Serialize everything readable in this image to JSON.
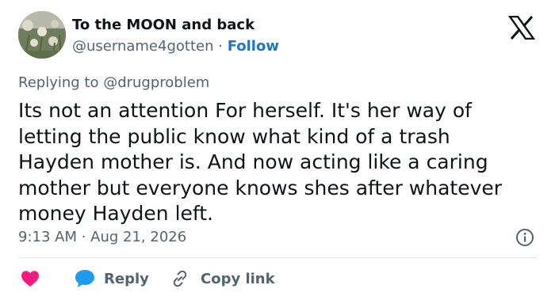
{
  "author": {
    "name": "To the MOON and back",
    "handle": "@username4gotten",
    "separator": "·",
    "follow_label": "Follow"
  },
  "logo": "x-logo-icon",
  "replying_to": "Replying to @drugproblem",
  "body": "Its not an attention For herself.  It's her way of\nletting the public know what kind of a trash\nHayden mother is. And now acting like a caring\nmother but everyone knows shes after whatever\nmoney Hayden left.",
  "timestamp": "9:13 AM · Aug 21, 2026",
  "actions": {
    "like_icon": "heart-icon",
    "reply_label": "Reply",
    "copy_label": "Copy link"
  },
  "colors": {
    "accent": "#1d76c9",
    "heart": "#f91880",
    "reply_bubble": "#1d9bf0",
    "muted_text": "#536471",
    "main_text": "#0f1419"
  }
}
